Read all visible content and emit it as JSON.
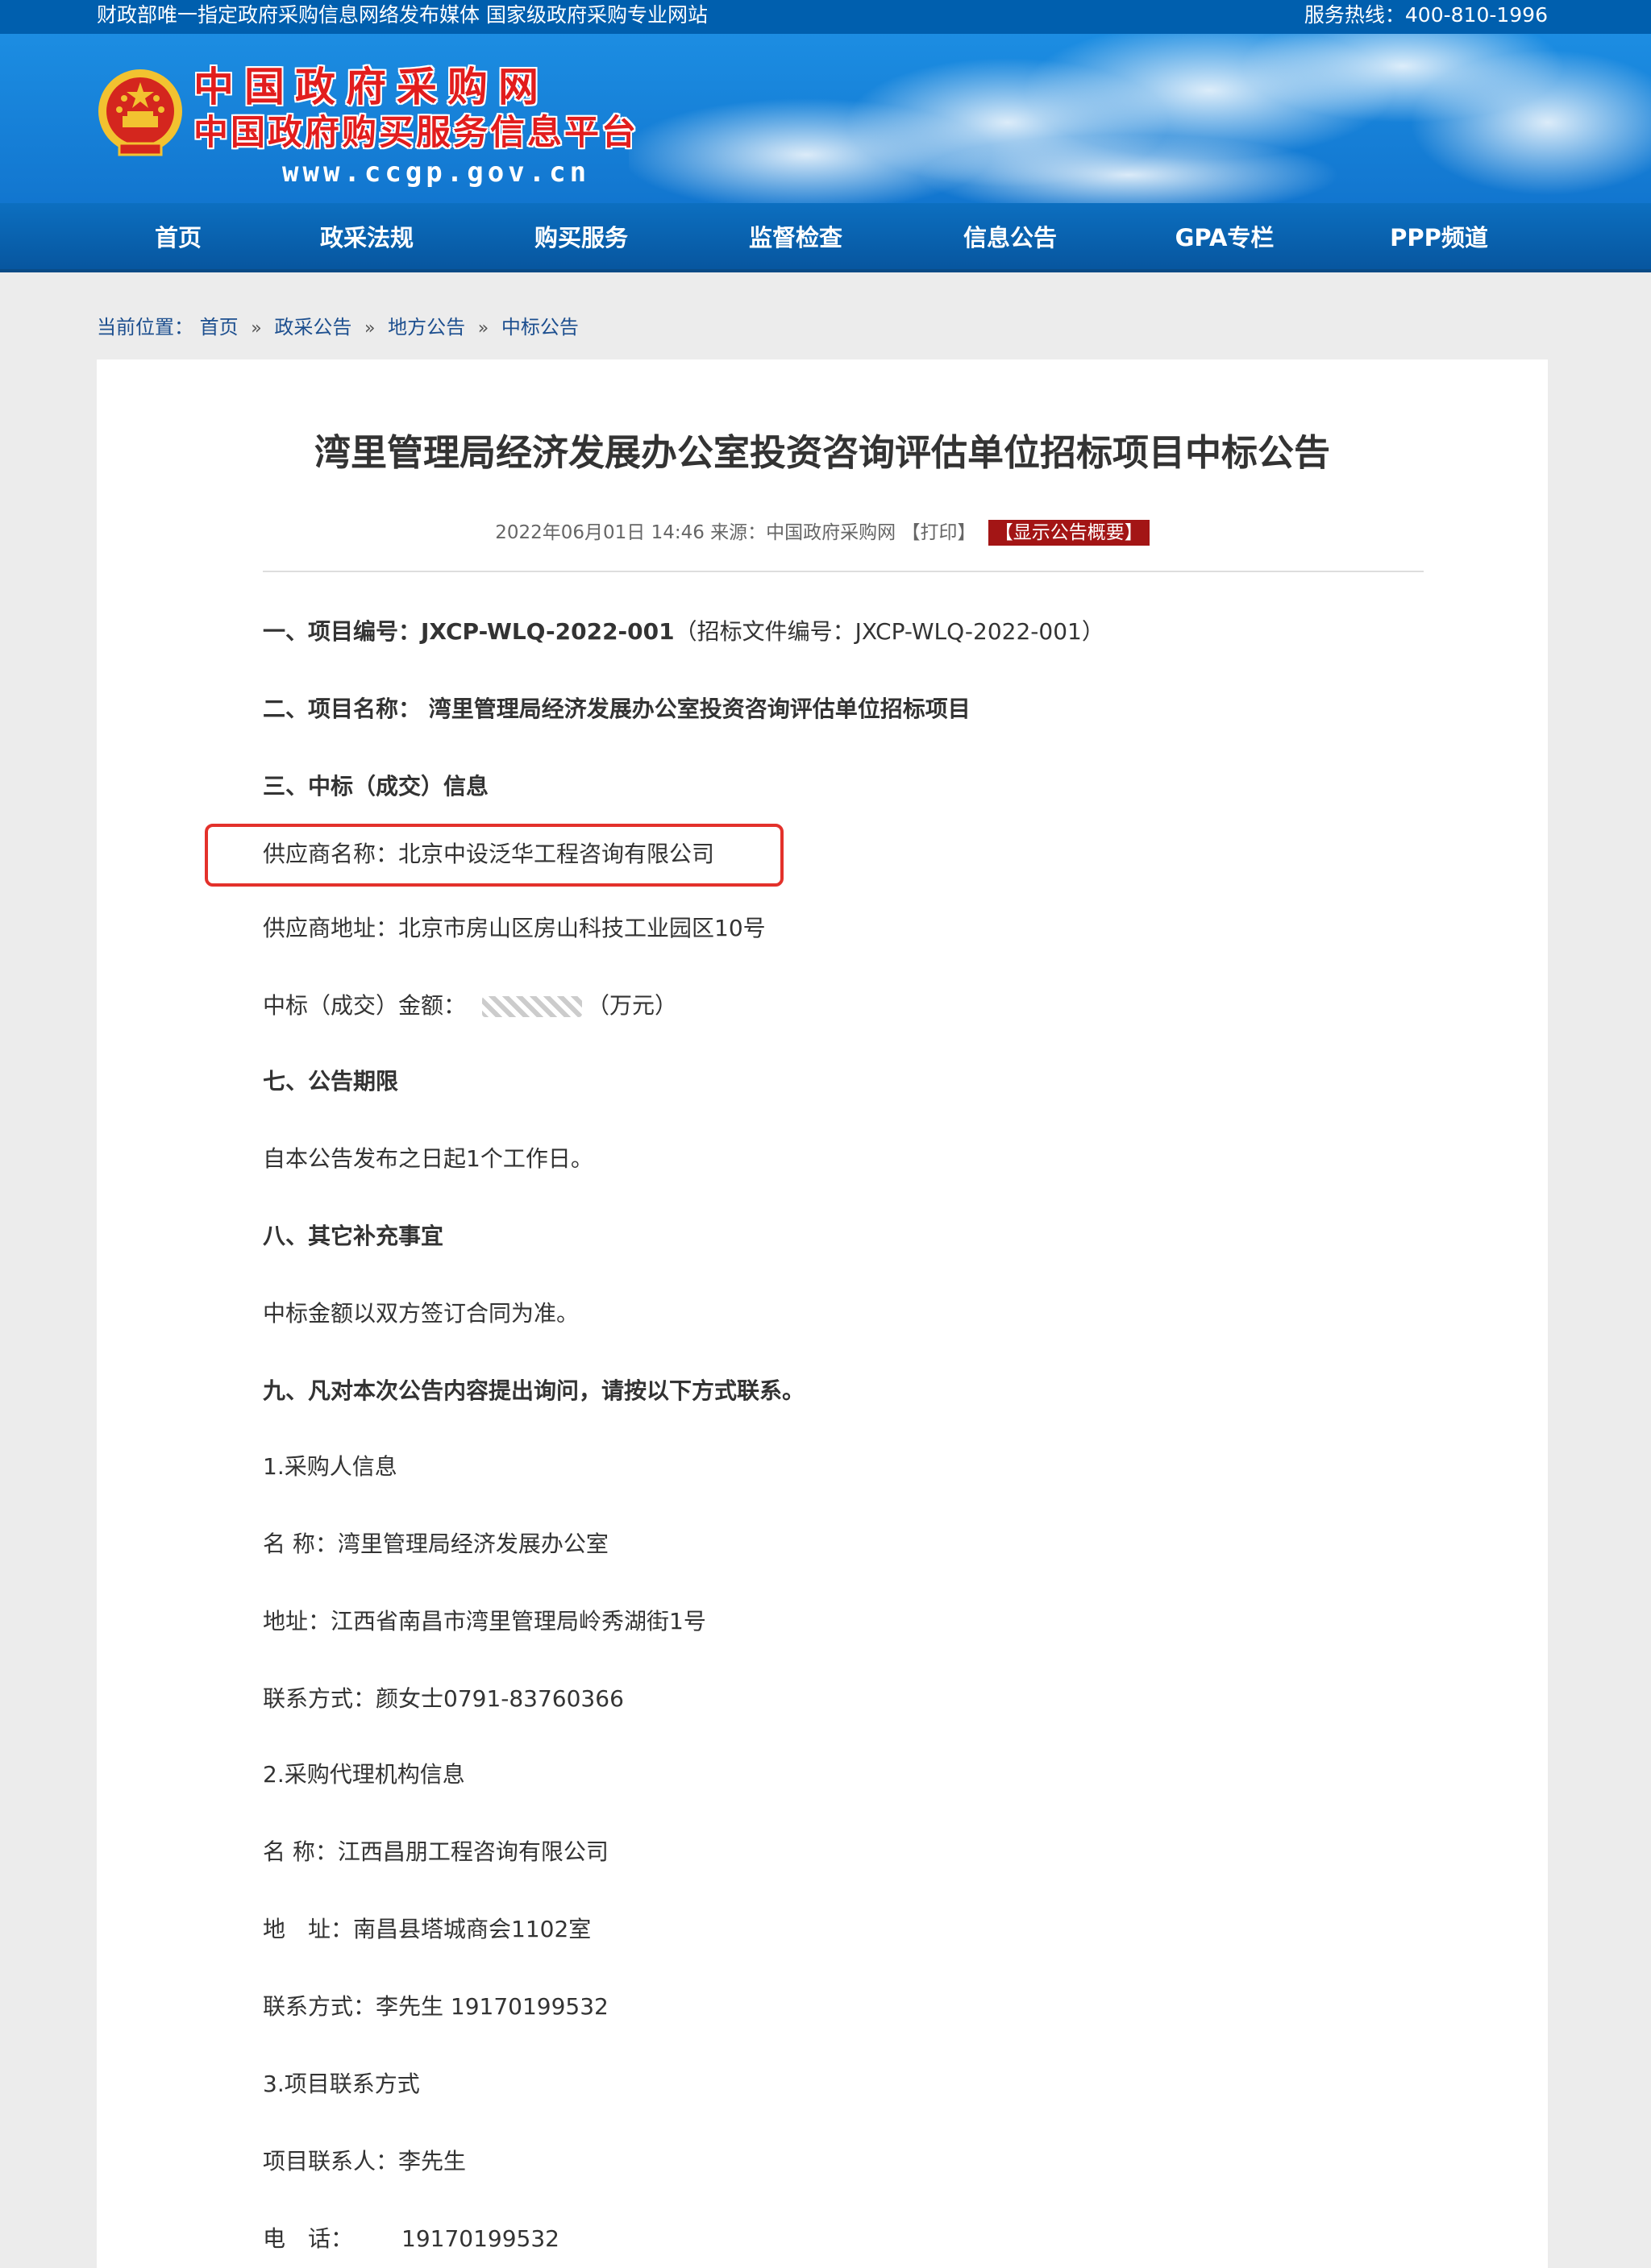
{
  "topbar": {
    "slogan": "财政部唯一指定政府采购信息网络发布媒体 国家级政府采购专业网站",
    "hotline": "服务热线：400-810-1996"
  },
  "brand": {
    "name": "中国政府采购网",
    "subtitle": "中国政府购买服务信息平台",
    "url": "www.ccgp.gov.cn"
  },
  "nav": {
    "items": [
      "首页",
      "政采法规",
      "购买服务",
      "监督检查",
      "信息公告",
      "GPA专栏",
      "PPP频道"
    ]
  },
  "breadcrumb": {
    "prefix": "当前位置：",
    "items": [
      "首页",
      "政采公告",
      "地方公告",
      "中标公告"
    ],
    "separator": "»"
  },
  "article": {
    "title": "湾里管理局经济发展办公室投资咨询评估单位招标项目中标公告",
    "meta": {
      "datetime": "2022年06月01日 14:46",
      "source": "来源：中国政府采购网",
      "print": "【打印】",
      "summary_button": "【显示公告概要】"
    },
    "lines": {
      "project_no": "一、项目编号：JXCP-WLQ-2022-001",
      "project_no_extra": "（招标文件编号：JXCP-WLQ-2022-001）",
      "project_name_label": "二、项目名称：",
      "project_name": "湾里管理局经济发展办公室投资咨询评估单位招标项目",
      "section3": "三、中标（成交）信息",
      "supplier_name": "供应商名称：北京中设泛华工程咨询有限公司",
      "supplier_address": "供应商地址：北京市房山区房山科技工业园区10号",
      "amount_label": "中标（成交）金额：",
      "amount_unit": "（万元）",
      "section7": "七、公告期限",
      "notice_period": "自本公告发布之日起1个工作日。",
      "section8": "八、其它补充事宜",
      "supplement": "中标金额以双方签订合同为准。",
      "section9": "九、凡对本次公告内容提出询问，请按以下方式联系。",
      "buyer_head": "1.采购人信息",
      "buyer_name": "名 称：湾里管理局经济发展办公室",
      "buyer_address": "地址：江西省南昌市湾里管理局岭秀湖街1号",
      "buyer_contact": "联系方式：颜女士0791-83760366",
      "agency_head": "2.采购代理机构信息",
      "agency_name": "名 称：江西昌朋工程咨询有限公司",
      "agency_address": "地　址：南昌县塔城商会1102室",
      "agency_contact": "联系方式：李先生 19170199532",
      "project_contact_head": "3.项目联系方式",
      "project_contact_person": "项目联系人：李先生",
      "phone_label": "电　话：",
      "phone_value": "19170199532"
    }
  },
  "colors": {
    "brand_blue": "#005fae",
    "nav_blue": "#07569f",
    "highlight_red": "#e3312b",
    "summary_red": "#a31515"
  }
}
